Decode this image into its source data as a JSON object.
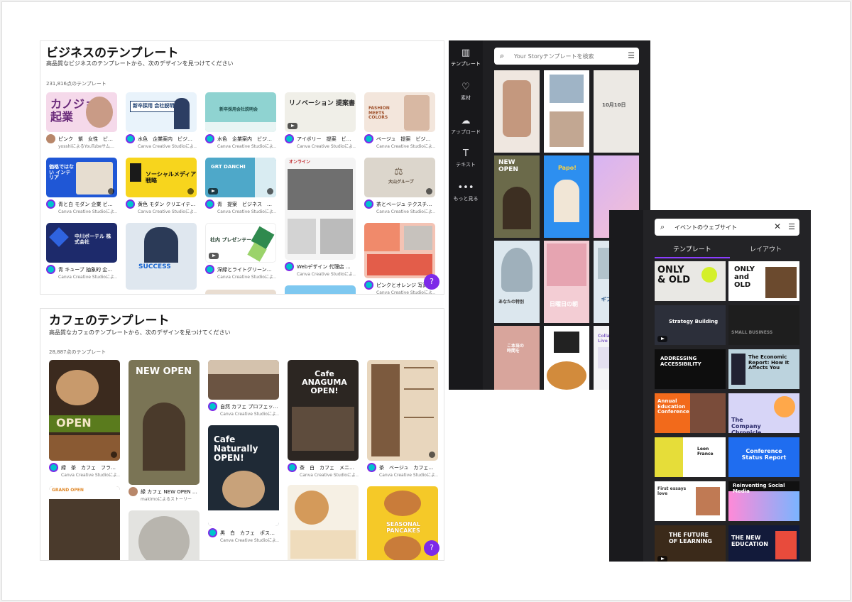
{
  "business": {
    "title": "ビジネスのテンプレート",
    "subtitle": "高品質なビジネスのテンプレートから、次のデザインを見つけてください",
    "count": "231,816点のテンプレート",
    "cards": [
      {
        "name": "ピンク　紫　女性　ビ…",
        "by": "yosshiによるYouTubeサム…",
        "thumb": "カノジョの 起業"
      },
      {
        "name": "水色　企業案内　ビジ…",
        "by": "Canva Creative Studioによ…",
        "thumb": "新卒採用 会社説明会"
      },
      {
        "name": "水色　企業案内　ビジ…",
        "by": "Canva Creative Studioによ…",
        "thumb": "新卒採用会社説明会"
      },
      {
        "name": "アイボリー　提案　ビジ…",
        "by": "Canva Creative Studioによ…",
        "thumb": "リノベーション 提案書"
      },
      {
        "name": "ベージュ　提案　ビジネ…",
        "by": "Canva Creative Studioによ…",
        "thumb": "FASHION MEETS COLORS"
      },
      {
        "name": "青と白 モダン 企業 ビジ…",
        "by": "Canva Creative Studioによ…",
        "thumb": "価格ではない インテリア"
      },
      {
        "name": "黄色 モダン クリエイテ…",
        "by": "Canva Creative Studioによ…",
        "thumb": "ソーシャルメディア 戦略"
      },
      {
        "name": "青　提案　ビジネス　…",
        "by": "Canva Creative Studioによ…",
        "thumb": "GRT DANCHI"
      },
      {
        "name": "Webデザイン 代理店 チ…",
        "by": "Canva Creative Studioによ…",
        "thumb": "オンライン"
      },
      {
        "name": "茶とベージュ テクスチ…",
        "by": "Canva Creative Studioによ…",
        "thumb": "大山グループ"
      },
      {
        "name": "青 キューブ 抽象的 企業…",
        "by": "Canva Creative Studioによ…",
        "thumb": "中川ボーテル 株式会社"
      },
      {
        "name": "",
        "by": "",
        "thumb": "SUCCESS"
      },
      {
        "name": "深緑とライトグリーンと…",
        "by": "Canva Creative Studioによ…",
        "thumb": "社内 プレゼンテーション"
      },
      {
        "name": "ピンクとオレンジ 写真…",
        "by": "Canva Creative Studioによ…",
        "thumb": ""
      }
    ]
  },
  "cafe": {
    "title": "カフェのテンプレート",
    "subtitle": "高品質なカフェのテンプレートから、次のデザインを見つけてください",
    "count": "28,887点のテンプレート",
    "cards": [
      {
        "name": "緑　茶　カフェ　フラ…",
        "by": "Canva Creative Studioによ…",
        "thumb": "OPEN"
      },
      {
        "name": "緑 カフェ NEW OPEN …",
        "by": "makimoによるストーリー",
        "thumb": "NEW OPEN"
      },
      {
        "name": "自然 カフェ プロフェッ…",
        "by": "Canva Creative Studioによ…",
        "thumb": ""
      },
      {
        "name": "茶　白　カフェ　メニ…",
        "by": "Canva Creative Studioによ…",
        "thumb": "Cafe ANAGUMA OPEN!"
      },
      {
        "name": "茶　ベージュ　カフェ…",
        "by": "Canva Creative Studioによ…",
        "thumb": ""
      },
      {
        "name": "黒　白　カフェ　ポス…",
        "by": "Canva Creative Studioによ…",
        "thumb": "Cafe Naturally OPEN!"
      },
      {
        "name": "",
        "by": "",
        "thumb": "GRAND OPEN"
      },
      {
        "name": "",
        "by": "",
        "thumb": "SEASONAL PANCAKES"
      }
    ]
  },
  "editor1": {
    "rail": [
      "テンプレート",
      "素材",
      "アップロード",
      "テキスト",
      "もっと見る"
    ],
    "search_placeholder": "Your Storyテンプレートを検索",
    "thumbs": [
      "",
      "",
      "10月10日",
      "NEW OPEN",
      "Papo!",
      "",
      "あなたの特別",
      "日曜日の朝",
      "ギフト券 プレゼント",
      "こ本当の時間を",
      "",
      "Collaboration Live"
    ]
  },
  "editor2": {
    "search_value": "イベントのウェブサイト",
    "tabs": [
      "テンプレート",
      "レイアウト"
    ],
    "thumbs": [
      "ONLY & OLD",
      "ONLY and OLD",
      "Strategy Building",
      "SMALL BUSINESS",
      "ADDRESSING ACCESSIBILITY",
      "The Economic Report: How It Affects You",
      "Annual Education Conference",
      "The Company Chronicle",
      "Leon France",
      "Conference Status Report",
      "First essays love",
      "Reinventing Social Media",
      "THE FUTURE OF LEARNING",
      "THE NEW EDUCATION"
    ]
  },
  "help_label": "?"
}
